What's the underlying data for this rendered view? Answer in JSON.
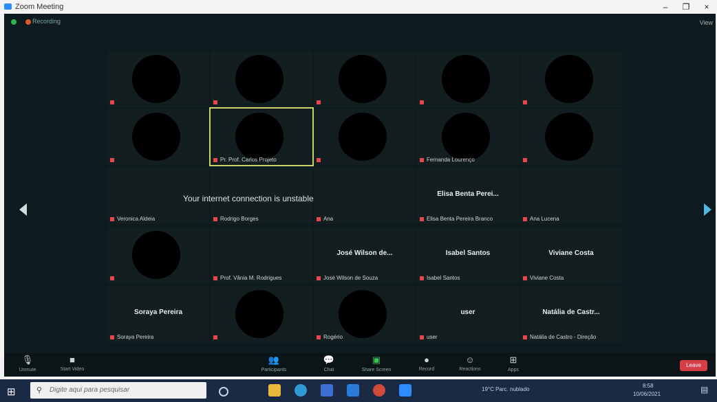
{
  "window": {
    "title": "Zoom Meeting",
    "min": "–",
    "max": "❐",
    "close": "×"
  },
  "topbar": {
    "status": "Recording",
    "view": "View"
  },
  "banner": "Your internet connection is unstable",
  "tiles": [
    {
      "name": "",
      "label": "",
      "blob": true
    },
    {
      "name": "",
      "label": "",
      "blob": true
    },
    {
      "name": "",
      "label": "",
      "blob": true
    },
    {
      "name": "",
      "label": "",
      "blob": true
    },
    {
      "name": "",
      "label": "",
      "blob": true
    },
    {
      "name": "",
      "label": "",
      "blob": true
    },
    {
      "name": "",
      "label": "Pr. Prof. Carlos Projeto",
      "blob": true,
      "active": true
    },
    {
      "name": "",
      "label": "",
      "blob": true
    },
    {
      "name": "",
      "label": "Fernanda Lourenço",
      "blob": true
    },
    {
      "name": "",
      "label": "",
      "blob": true
    },
    {
      "name": "",
      "label": "Veronica Aldeia",
      "blob": false
    },
    {
      "name": "",
      "label": "Rodrigo Borges",
      "blob": false
    },
    {
      "name": "",
      "label": "Ana",
      "blob": false
    },
    {
      "name": "Elisa Benta Perei...",
      "label": "Elisa Benta Pereira Branco",
      "blob": false
    },
    {
      "name": "",
      "label": "Ana Lucena",
      "blob": false
    },
    {
      "name": "",
      "label": "",
      "blob": true
    },
    {
      "name": "",
      "label": "Prof. Vânia M. Rodrigues",
      "blob": false
    },
    {
      "name": "José Wilson de...",
      "label": "José Wilson de Souza",
      "blob": false
    },
    {
      "name": "Isabel Santos",
      "label": "Isabel Santos",
      "blob": false
    },
    {
      "name": "Viviane Costa",
      "label": "Viviane Costa",
      "blob": false
    },
    {
      "name": "Soraya Pereira",
      "label": "Soraya Pereira",
      "blob": false
    },
    {
      "name": "",
      "label": "",
      "blob": true
    },
    {
      "name": "",
      "label": "Rogério",
      "blob": true
    },
    {
      "name": "user",
      "label": "user",
      "blob": false
    },
    {
      "name": "Natália de Castr...",
      "label": "Natália de Castro - Direção",
      "blob": false
    }
  ],
  "controls": {
    "mute": "Unmute",
    "video": "Start Video",
    "participants": "Participants",
    "chat": "Chat",
    "share": "Share Screen",
    "record": "Record",
    "reactions": "Reactions",
    "apps": "Apps",
    "leave": "Leave"
  },
  "taskbar": {
    "search_placeholder": "Digite aqui para pesquisar",
    "weather": "19°C Parc. nublado",
    "time": "8:58",
    "date": "10/06/2021"
  },
  "colors": {
    "stage": "#0e1b1e",
    "accent": "#2d8cff",
    "leave": "#d83c47"
  }
}
